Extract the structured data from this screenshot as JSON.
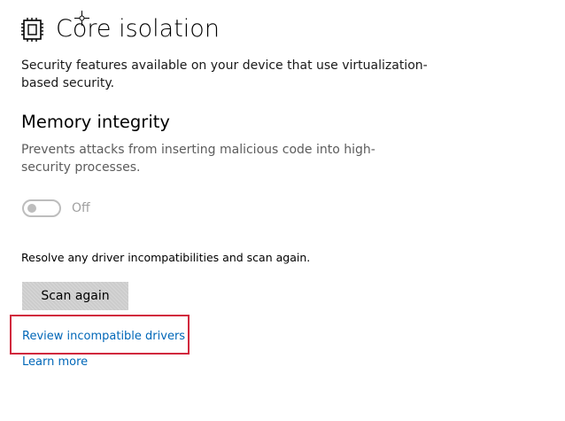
{
  "header": {
    "title": "Core isolation",
    "icon": "chip-icon"
  },
  "description": "Security features available on your device that use virtualization-based security.",
  "memory_integrity": {
    "title": "Memory integrity",
    "description": "Prevents attacks from inserting malicious code into high-security processes.",
    "toggle": {
      "state": "Off",
      "on": false,
      "enabled": false
    }
  },
  "resolve_text": "Resolve any driver incompatibilities and scan again.",
  "scan_button": {
    "label": "Scan again"
  },
  "links": {
    "review": "Review incompatible drivers",
    "learn_more": "Learn more"
  },
  "colors": {
    "link": "#0067b8",
    "highlight_border": "#d1283d",
    "button_bg": "#cccccc",
    "toggle_disabled": "#bdbdbd"
  }
}
